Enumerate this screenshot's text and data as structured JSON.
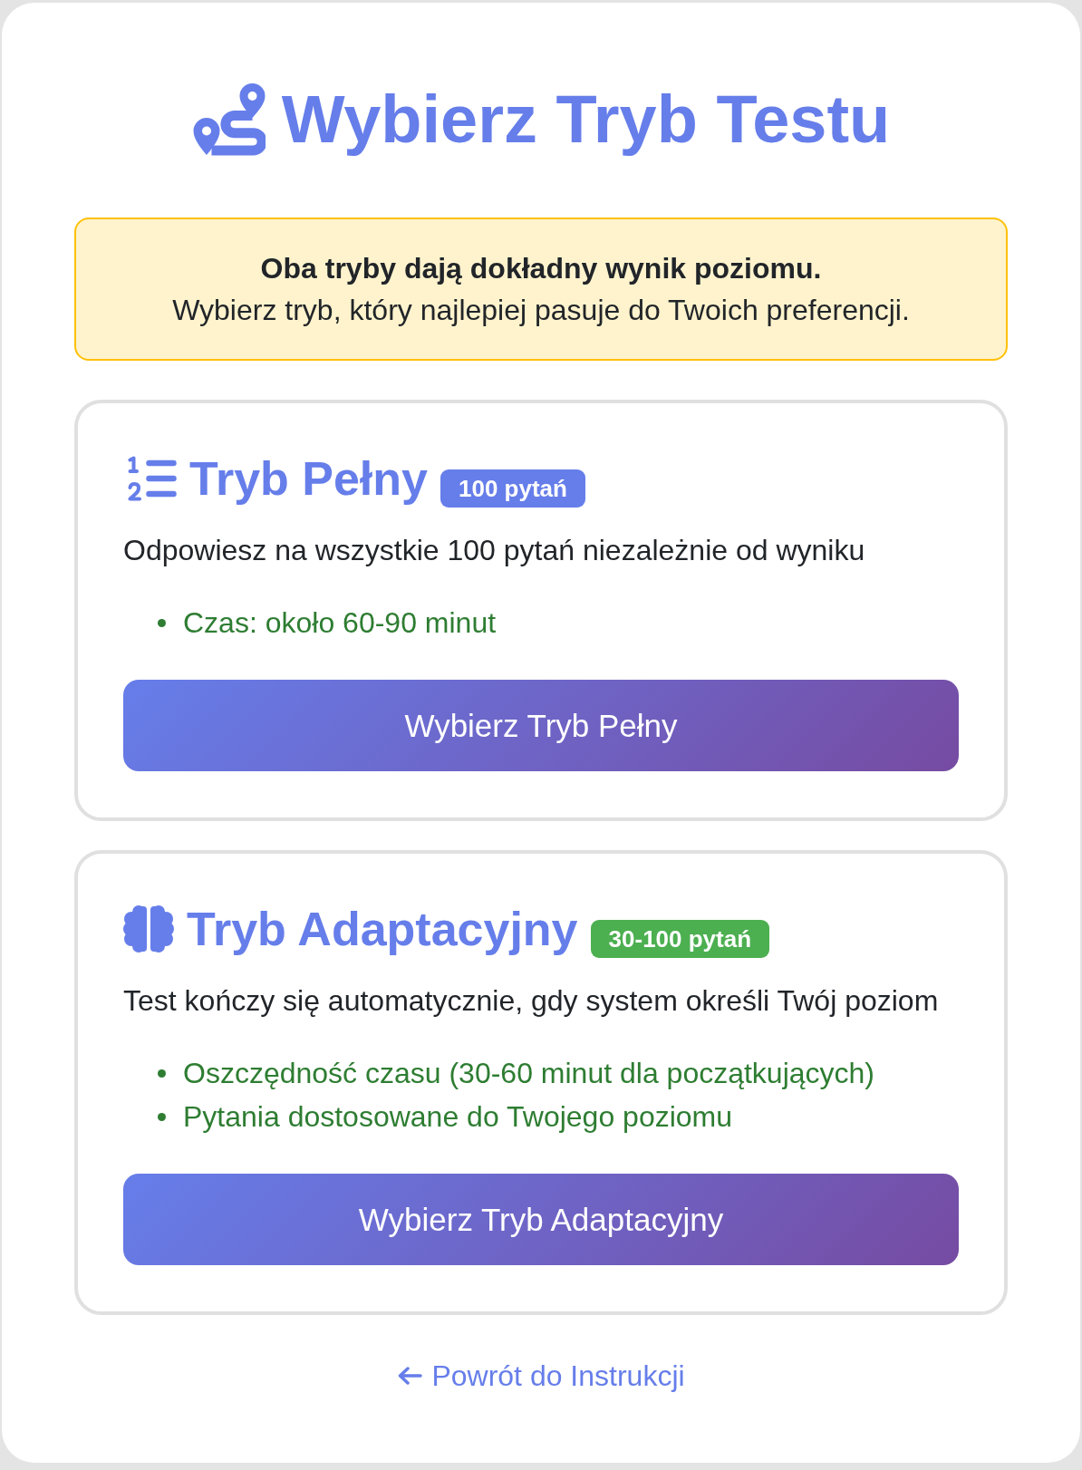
{
  "header": {
    "title": "Wybierz Tryb Testu"
  },
  "notice": {
    "heading": "Oba tryby dają dokładny wynik poziomu.",
    "text": "Wybierz tryb, który najlepiej pasuje do Twoich preferencji."
  },
  "modes": [
    {
      "kind": "full",
      "title": "Tryb Pełny",
      "badge": {
        "label": "100 pytań",
        "color": "#667eea"
      },
      "description": "Odpowiesz na wszystkie 100 pytań niezależnie od wyniku",
      "features": [
        "Czas: około 60-90 minut"
      ],
      "button": "Wybierz Tryb Pełny"
    },
    {
      "kind": "adaptive",
      "title": "Tryb Adaptacyjny",
      "badge": {
        "label": "30-100 pytań",
        "color": "#4caf50"
      },
      "description": "Test kończy się automatycznie, gdy system określi Twój poziom",
      "features": [
        "Oszczędność czasu (30-60 minut dla początkujących)",
        "Pytania dostosowane do Twojego poziomu"
      ],
      "button": "Wybierz Tryb Adaptacyjny"
    }
  ],
  "back_link": {
    "label": "Powrót do Instrukcji"
  }
}
